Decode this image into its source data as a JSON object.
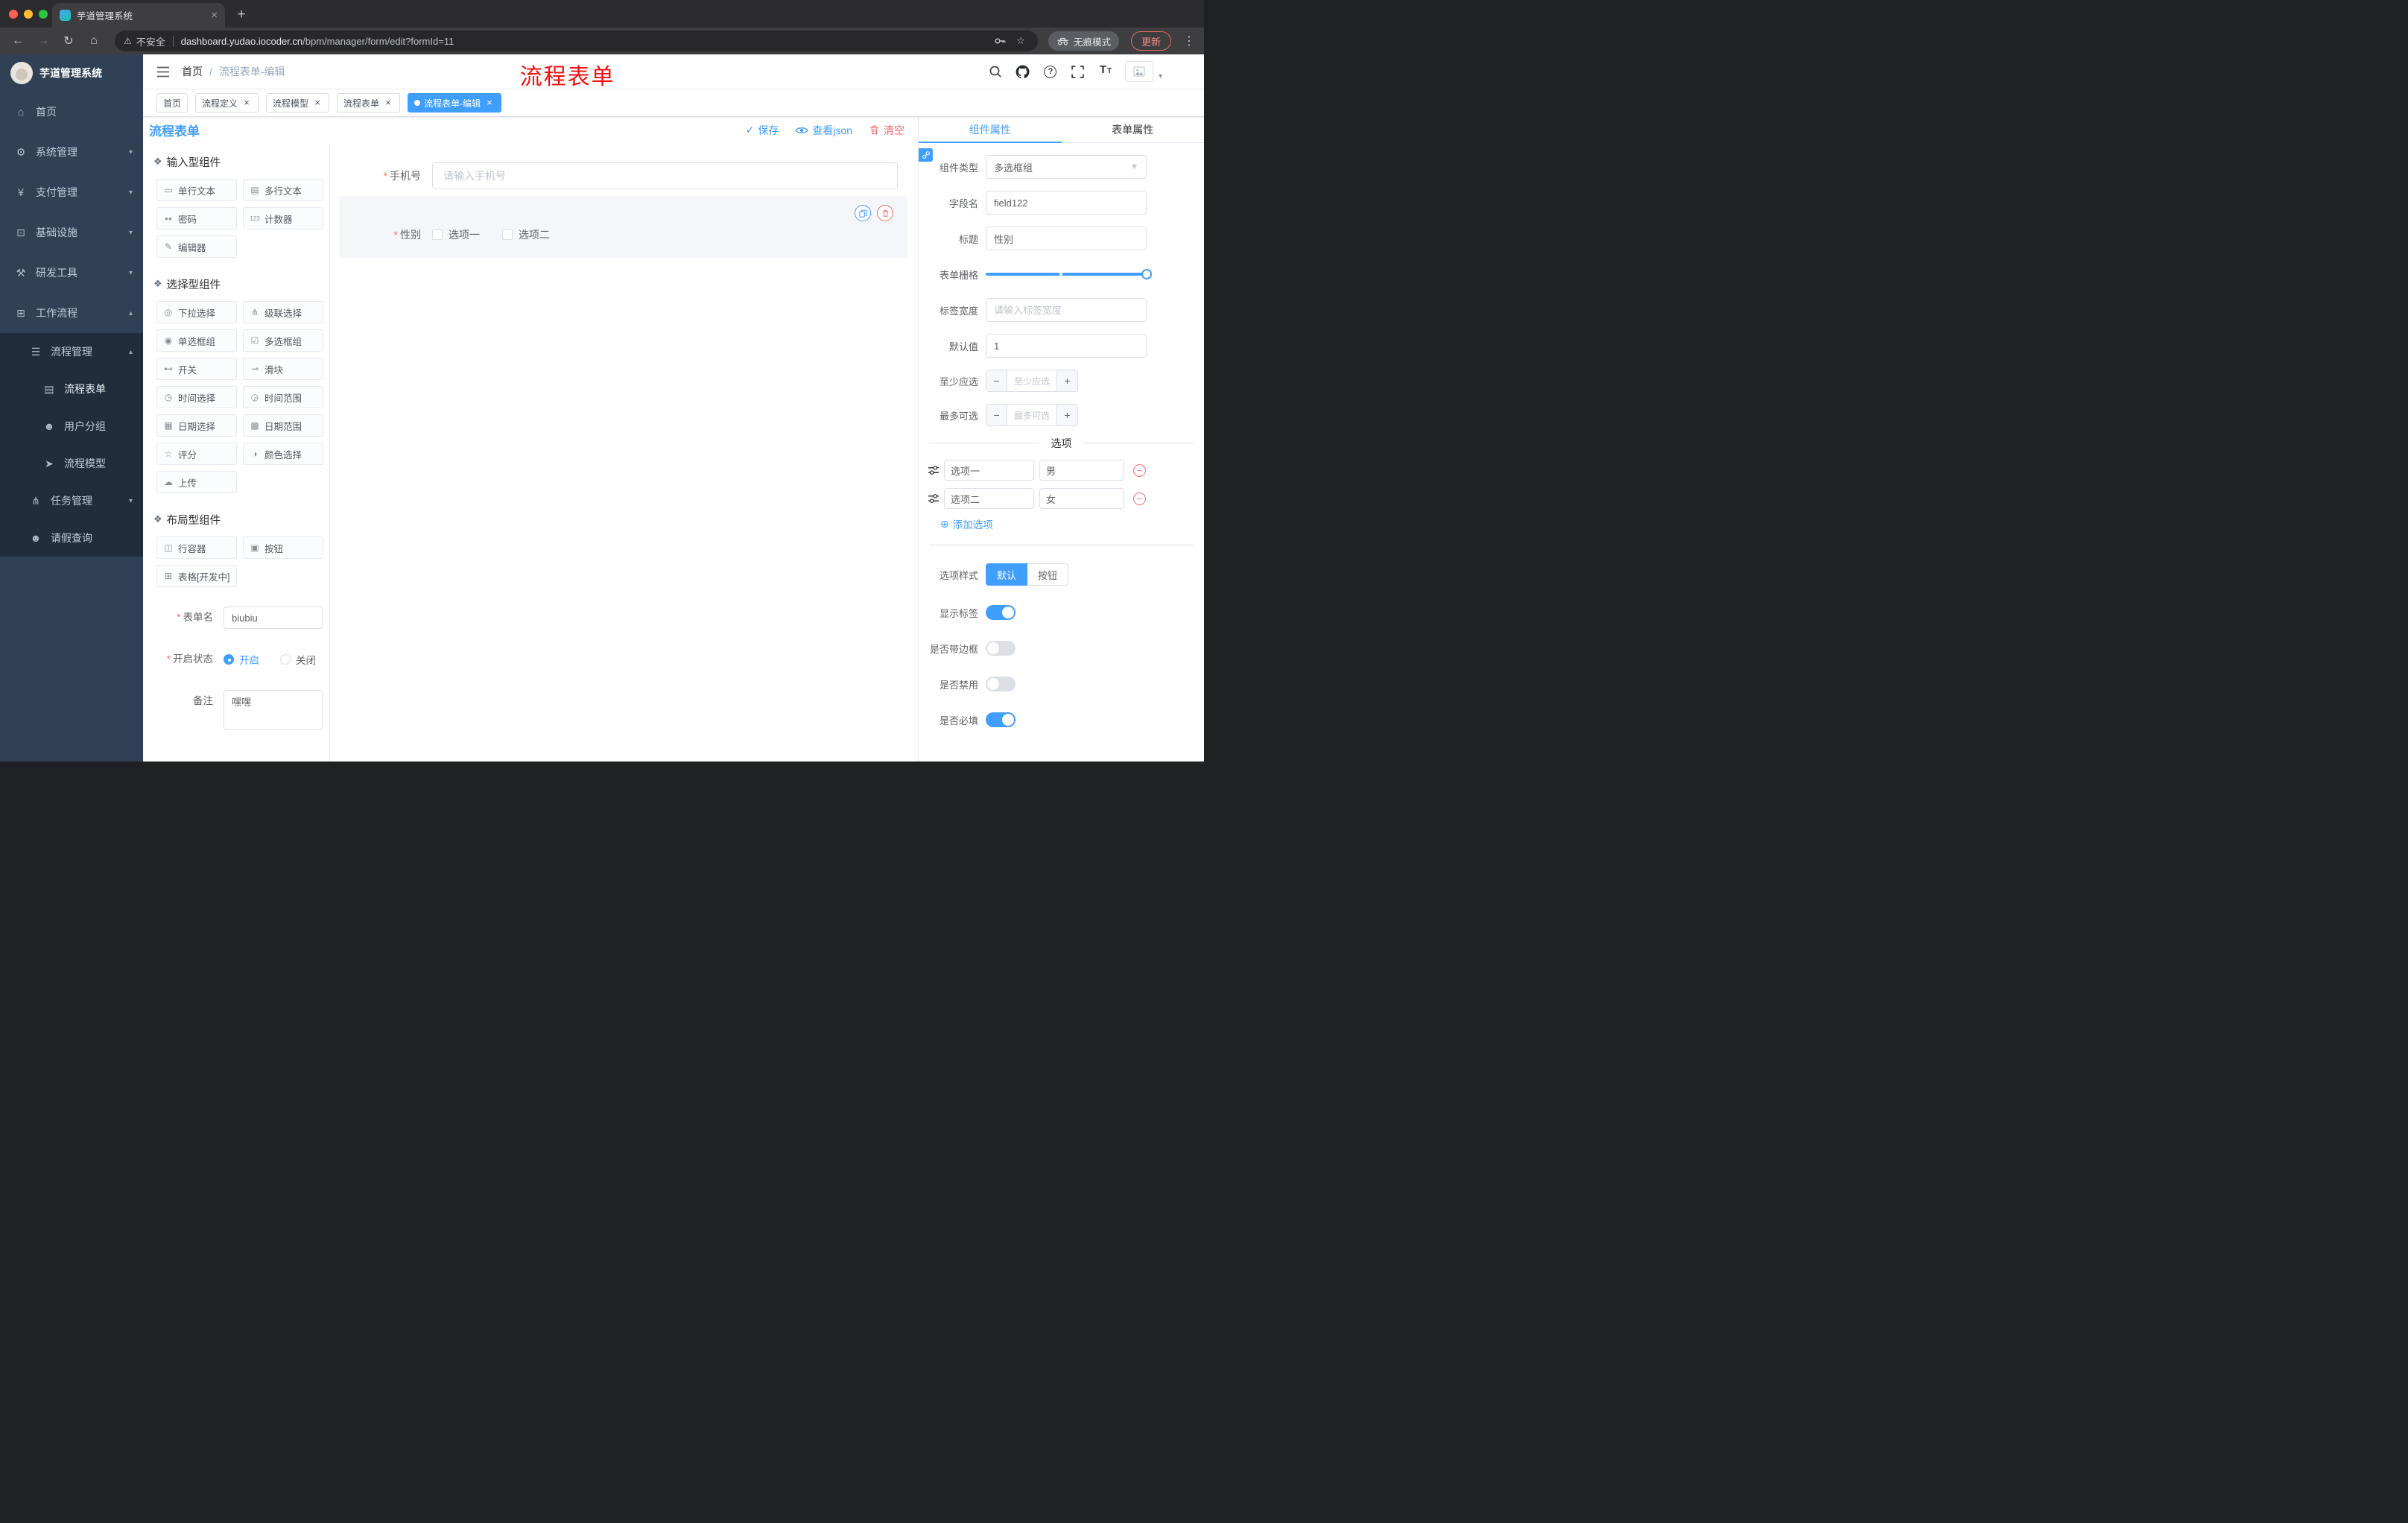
{
  "browser": {
    "tab_title": "芋道管理系统",
    "security_label": "不安全",
    "url_domain": "dashboard.yudao.iocoder.cn",
    "url_path": "/bpm/manager/form/edit?formId=11",
    "incognito_label": "无痕模式",
    "update_label": "更新"
  },
  "annotation": {
    "text": "流程表单"
  },
  "sidebar": {
    "logo_title": "芋道管理系统",
    "menu": [
      {
        "name": "home",
        "label": "首页",
        "icon": "home-icon",
        "chevron": ""
      },
      {
        "name": "system-manage",
        "label": "系统管理",
        "icon": "gear-icon",
        "chevron": "down"
      },
      {
        "name": "payment-manage",
        "label": "支付管理",
        "icon": "payment-icon",
        "chevron": "down"
      },
      {
        "name": "infrastructure",
        "label": "基础设施",
        "icon": "infrastructure-icon",
        "chevron": "down"
      },
      {
        "name": "dev-tools",
        "label": "研发工具",
        "icon": "devtools-icon",
        "chevron": "down"
      },
      {
        "name": "workflow",
        "label": "工作流程",
        "icon": "workflow-icon",
        "chevron": "up"
      }
    ],
    "submenu": [
      {
        "name": "process-manage",
        "label": "流程管理",
        "icon": "process-manage-icon",
        "level": 1,
        "chevron": "up",
        "active": false
      },
      {
        "name": "process-form",
        "label": "流程表单",
        "icon": "process-form-icon",
        "level": 2,
        "chevron": "",
        "active": true
      },
      {
        "name": "user-group",
        "label": "用户分组",
        "icon": "user-group-icon",
        "level": 2,
        "chevron": "",
        "active": false
      },
      {
        "name": "process-model",
        "label": "流程模型",
        "icon": "process-model-icon",
        "level": 2,
        "chevron": "",
        "active": false
      },
      {
        "name": "task-manage",
        "label": "任务管理",
        "icon": "task-manage-icon",
        "level": 1,
        "chevron": "down",
        "active": false
      },
      {
        "name": "leave-query",
        "label": "请假查询",
        "icon": "leave-query-icon",
        "level": 1,
        "chevron": "",
        "active": false
      }
    ]
  },
  "header": {
    "breadcrumb_home": "首页",
    "breadcrumb_separator": "/",
    "breadcrumb_current": "流程表单-编辑"
  },
  "tags": [
    {
      "name": "home",
      "label": "首页",
      "closable": false,
      "active": false
    },
    {
      "name": "process-definition",
      "label": "流程定义",
      "closable": true,
      "active": false
    },
    {
      "name": "process-model",
      "label": "流程模型",
      "closable": true,
      "active": false
    },
    {
      "name": "process-form",
      "label": "流程表单",
      "closable": true,
      "active": false
    },
    {
      "name": "process-form-edit",
      "label": "流程表单-编辑",
      "closable": true,
      "active": true
    }
  ],
  "toolbar": {
    "title": "流程表单",
    "save_label": "保存",
    "view_json_label": "查看json",
    "clear_label": "清空"
  },
  "palette": {
    "groups": [
      {
        "title": "输入型组件",
        "items": [
          {
            "name": "single-line-text",
            "label": "单行文本",
            "icon": "input-icon"
          },
          {
            "name": "multi-line-text",
            "label": "多行文本",
            "icon": "textarea-icon"
          },
          {
            "name": "password",
            "label": "密码",
            "icon": "password-icon"
          },
          {
            "name": "counter",
            "label": "计数器",
            "icon": "counter-icon"
          },
          {
            "name": "editor",
            "label": "编辑器",
            "icon": "editor-icon"
          }
        ]
      },
      {
        "title": "选择型组件",
        "items": [
          {
            "name": "select",
            "label": "下拉选择",
            "icon": "select-icon"
          },
          {
            "name": "cascader",
            "label": "级联选择",
            "icon": "cascader-icon"
          },
          {
            "name": "radio-group",
            "label": "单选框组",
            "icon": "radio-group-icon"
          },
          {
            "name": "checkbox-group",
            "label": "多选框组",
            "icon": "checkbox-group-icon"
          },
          {
            "name": "switch",
            "label": "开关",
            "icon": "switch-icon"
          },
          {
            "name": "slider",
            "label": "滑块",
            "icon": "slider-icon"
          },
          {
            "name": "time-picker",
            "label": "时间选择",
            "icon": "time-picker-icon"
          },
          {
            "name": "time-range",
            "label": "时间范围",
            "icon": "time-range-icon"
          },
          {
            "name": "date-picker",
            "label": "日期选择",
            "icon": "date-picker-icon"
          },
          {
            "name": "date-range",
            "label": "日期范围",
            "icon": "date-range-icon"
          },
          {
            "name": "rate",
            "label": "评分",
            "icon": "rate-icon"
          },
          {
            "name": "color-picker",
            "label": "颜色选择",
            "icon": "color-picker-icon"
          },
          {
            "name": "upload",
            "label": "上传",
            "icon": "upload-icon"
          }
        ]
      },
      {
        "title": "布局型组件",
        "items": [
          {
            "name": "row-container",
            "label": "行容器",
            "icon": "row-container-icon"
          },
          {
            "name": "button",
            "label": "按钮",
            "icon": "button-icon"
          },
          {
            "name": "table",
            "label": "表格[开发中]",
            "icon": "table-icon"
          }
        ]
      }
    ],
    "form": {
      "name_label": "表单名",
      "name_value": "biubiu",
      "status_label": "开启状态",
      "status_on": "开启",
      "status_off": "关闭",
      "remark_label": "备注",
      "remark_value": "嘿嘿"
    }
  },
  "canvas": {
    "phone": {
      "label": "手机号",
      "placeholder": "请输入手机号"
    },
    "gender": {
      "label": "性别",
      "option1": "选项一",
      "option2": "选项二"
    }
  },
  "properties": {
    "tab_component": "组件属性",
    "tab_form": "表单属性",
    "component_type_label": "组件类型",
    "component_type_value": "多选框组",
    "field_name_label": "字段名",
    "field_name_value": "field122",
    "title_label": "标题",
    "title_value": "性别",
    "grid_label": "表单栅格",
    "label_width_label": "标签宽度",
    "label_width_placeholder": "请输入标签宽度",
    "default_label": "默认值",
    "default_value": "1",
    "min_label": "至少应选",
    "min_placeholder": "至少应选",
    "max_label": "最多可选",
    "max_placeholder": "最多可选",
    "options_divider": "选项",
    "options": [
      {
        "label": "选项一",
        "value": "男"
      },
      {
        "label": "选项二",
        "value": "女"
      }
    ],
    "add_option_label": "添加选项",
    "option_style_label": "选项样式",
    "option_style_default": "默认",
    "option_style_button": "按钮",
    "switches": [
      {
        "name": "show-label",
        "label": "显示标签",
        "on": true
      },
      {
        "name": "border",
        "label": "是否带边框",
        "on": false
      },
      {
        "name": "disabled",
        "label": "是否禁用",
        "on": false
      },
      {
        "name": "required",
        "label": "是否必填",
        "on": true
      }
    ]
  },
  "icons": {
    "home-icon": "⌂",
    "gear-icon": "⚙",
    "payment-icon": "¥",
    "infrastructure-icon": "⊡",
    "devtools-icon": "⚒",
    "workflow-icon": "⊞",
    "process-manage-icon": "☰",
    "process-form-icon": "▤",
    "user-group-icon": "☻",
    "process-model-icon": "➤",
    "task-manage-icon": "⋔",
    "leave-query-icon": "☻",
    "group-icon": "❖",
    "input-icon": "▭",
    "textarea-icon": "▤",
    "password-icon": "●●",
    "counter-icon": "123",
    "editor-icon": "✎",
    "select-icon": "◎",
    "cascader-icon": "⋔",
    "radio-group-icon": "◉",
    "checkbox-group-icon": "☑",
    "switch-icon": "⊷",
    "slider-icon": "⊸",
    "time-picker-icon": "◷",
    "time-range-icon": "◶",
    "date-picker-icon": "▦",
    "date-range-icon": "▩",
    "rate-icon": "☆",
    "color-picker-icon": "◑",
    "upload-icon": "☁",
    "row-container-icon": "◫",
    "button-icon": "▣",
    "table-icon": "⊞"
  },
  "colors": {
    "primary": "#409eff",
    "danger": "#f56c6c",
    "sidebar": "#304156",
    "sidebar_sub": "#1f2d3d"
  }
}
